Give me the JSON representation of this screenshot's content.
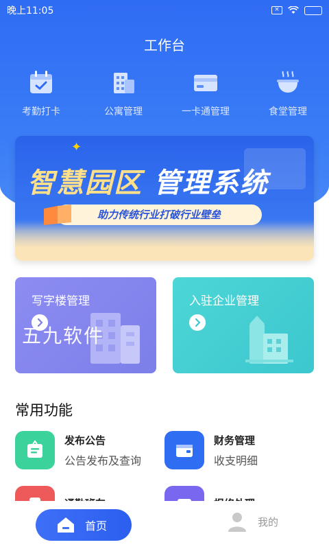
{
  "status": {
    "time": "晚上11:05"
  },
  "header": {
    "title": "工作台"
  },
  "quick": [
    {
      "label": "考勤打卡",
      "icon": "calendar-check-icon"
    },
    {
      "label": "公寓管理",
      "icon": "building-icon"
    },
    {
      "label": "一卡通管理",
      "icon": "card-icon"
    },
    {
      "label": "食堂管理",
      "icon": "bowl-icon"
    }
  ],
  "banner": {
    "title_part1": "智慧园区",
    "title_part2": "管理系统",
    "subtitle": "助力传统行业打破行业壁垒"
  },
  "cards": [
    {
      "title": "写字楼管理"
    },
    {
      "title": "入驻企业管理"
    }
  ],
  "watermark": "五九软件",
  "section": {
    "title": "常用功能"
  },
  "functions": [
    {
      "title": "发布公告",
      "desc": "公告发布及查询",
      "color": "#3bd29b"
    },
    {
      "title": "财务管理",
      "desc": "收支明细",
      "color": "#2f6df2"
    },
    {
      "title": "通勤班车",
      "desc": "",
      "color": "#ee5a5a"
    },
    {
      "title": "报修处理",
      "desc": "",
      "color": "#7a67f0"
    }
  ],
  "tabbar": {
    "home": "首页",
    "me": "我的"
  }
}
